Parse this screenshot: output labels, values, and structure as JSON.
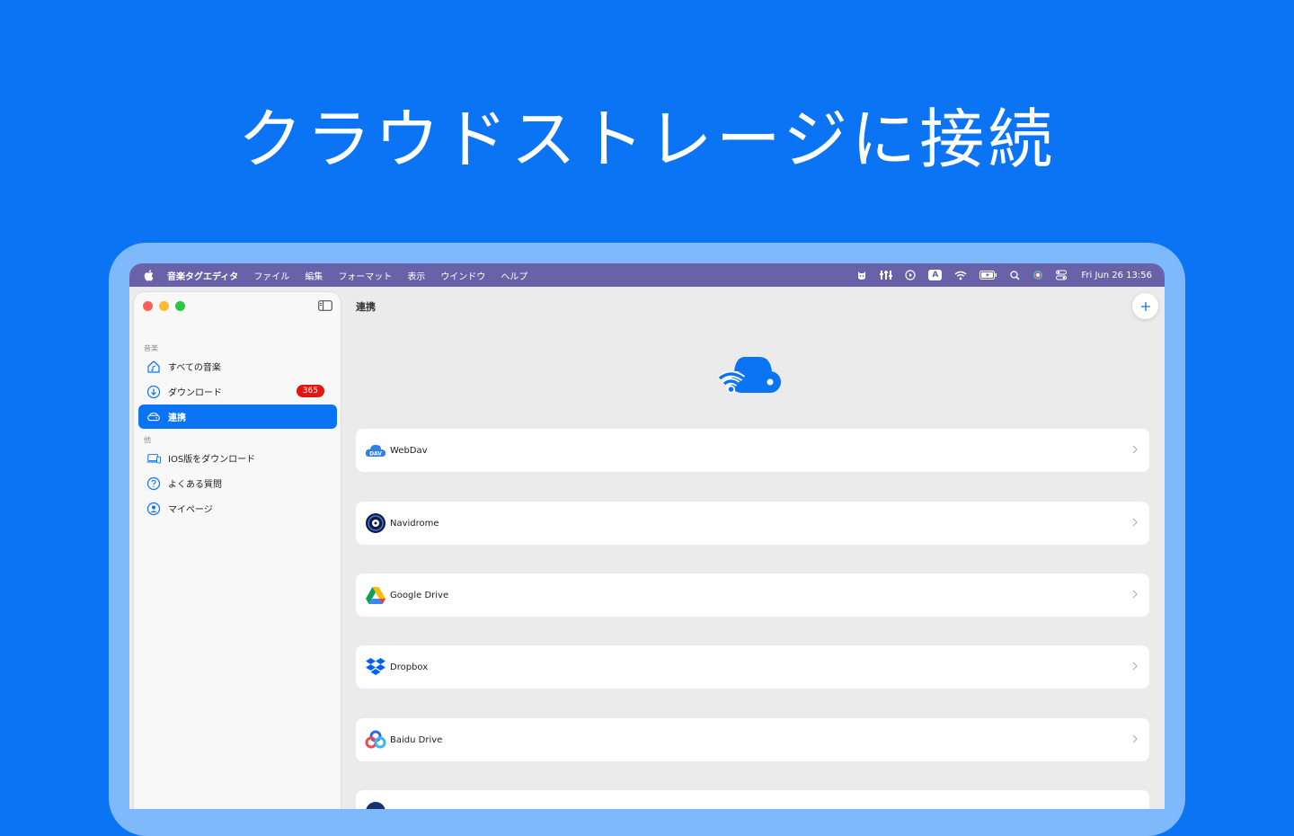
{
  "headline": "クラウドストレージに接続",
  "menubar": {
    "app_name": "音楽タグエディタ",
    "menus": [
      "ファイル",
      "編集",
      "フォーマット",
      "表示",
      "ウインドウ",
      "ヘルプ"
    ],
    "input_badge": "A",
    "clock": "Fri Jun 26  13:56"
  },
  "sidebar": {
    "section_music": "音楽",
    "section_other": "他",
    "items": [
      {
        "label": "すべての音楽",
        "icon": "house-music-icon"
      },
      {
        "label": "ダウンロード",
        "icon": "download-circle-icon",
        "badge": "365"
      },
      {
        "label": "連携",
        "icon": "cloud-drive-icon",
        "active": true
      },
      {
        "label": "IOS版をダウンロード",
        "icon": "laptop-phone-icon"
      },
      {
        "label": "よくある質問",
        "icon": "question-circle-icon"
      },
      {
        "label": "マイページ",
        "icon": "person-circle-icon"
      }
    ]
  },
  "content": {
    "title": "連携",
    "services": [
      {
        "label": "WebDav",
        "icon": "webdav-cloud-icon"
      },
      {
        "label": "Navidrome",
        "icon": "navidrome-disc-icon"
      },
      {
        "label": "Google Drive",
        "icon": "google-drive-icon"
      },
      {
        "label": "Dropbox",
        "icon": "dropbox-icon"
      },
      {
        "label": "Baidu Drive",
        "icon": "baidu-drive-icon"
      }
    ]
  },
  "colors": {
    "accent": "#0A74F5",
    "badge": "#E5150F",
    "menubar": "#6A62A8"
  }
}
